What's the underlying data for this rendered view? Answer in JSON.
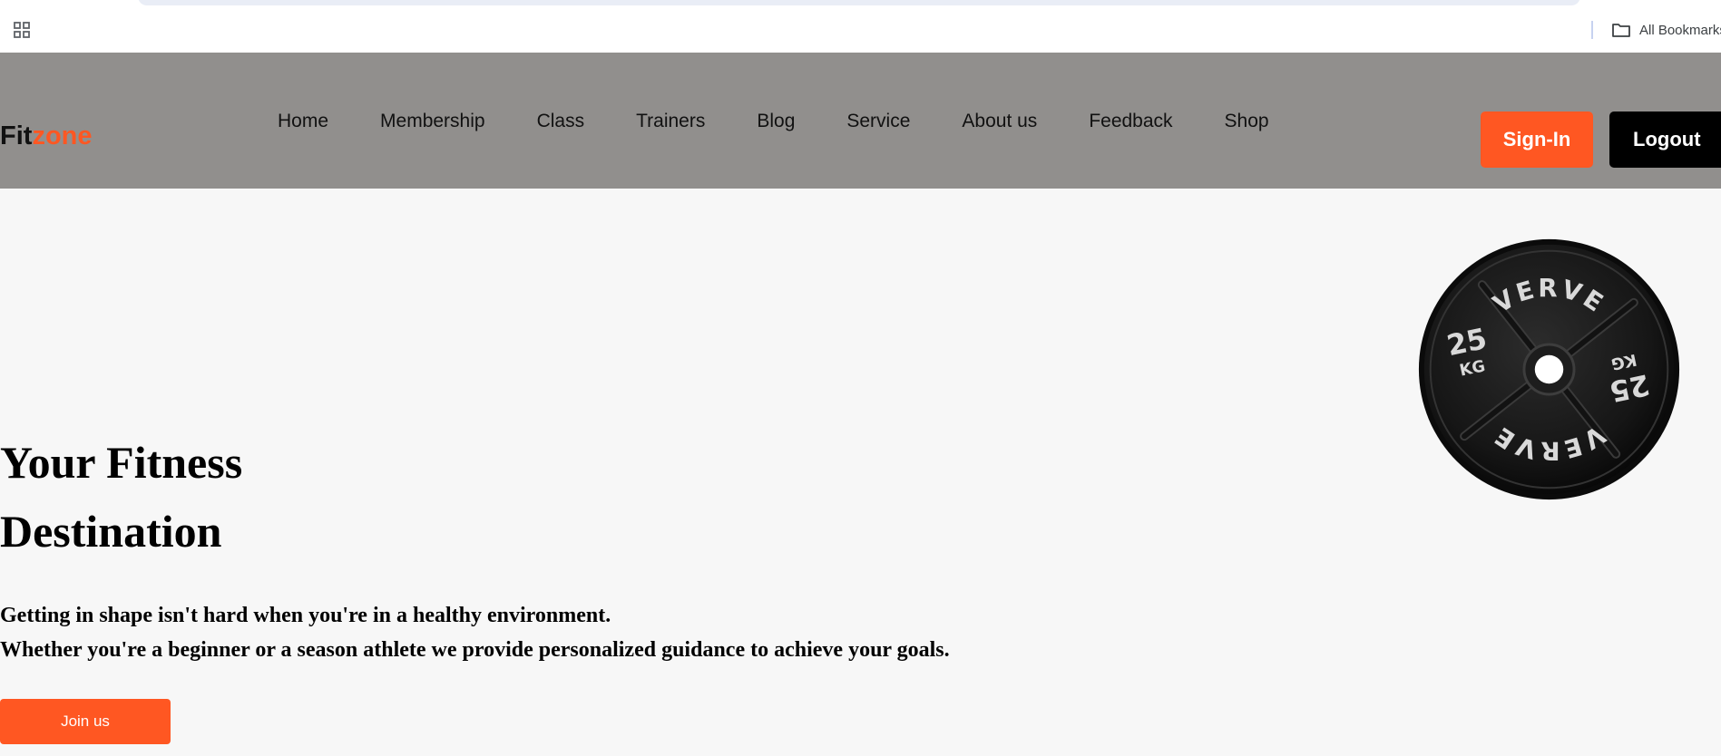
{
  "browser": {
    "all_bookmarks_label": "All Bookmarks"
  },
  "navbar": {
    "logo": {
      "part1": "Fit",
      "part2": "zone",
      "accent_color": "#ff5722"
    },
    "links": [
      {
        "label": "Home"
      },
      {
        "label": "Membership"
      },
      {
        "label": "Class"
      },
      {
        "label": "Trainers"
      },
      {
        "label": "Blog"
      },
      {
        "label": "Service"
      },
      {
        "label": "About us"
      },
      {
        "label": "Feedback"
      },
      {
        "label": "Shop"
      }
    ],
    "signin_label": "Sign-In",
    "logout_label": "Logout",
    "background_color": "#918f8d"
  },
  "hero": {
    "title_line1": "Your Fitness",
    "title_line2": "Destination",
    "description_line1": "Getting in shape isn't hard when you're in a healthy environment.",
    "description_line2": "Whether you're a beginner or a season athlete we provide personalized guidance to achieve your goals.",
    "cta_label": "Join us",
    "image": {
      "icon": "weight-plate-icon",
      "brand_text": "VERVE",
      "weight_number": "25",
      "weight_unit": "KG"
    }
  }
}
